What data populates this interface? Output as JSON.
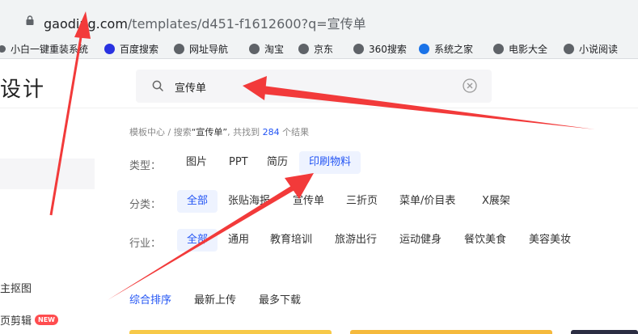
{
  "browser": {
    "url_host": "gaoding.com",
    "url_path": "/templates/d451-f1612600?q=宣传单"
  },
  "bookmarks": [
    {
      "label": "小白一键重装系统",
      "icon": "globe-icon",
      "color": "#5f6368"
    },
    {
      "label": "百度搜索",
      "icon": "baidu-paw-icon",
      "color": "#2932e1"
    },
    {
      "label": "网址导航",
      "icon": "globe-icon",
      "color": "#5f6368"
    },
    {
      "label": "淘宝",
      "icon": "globe-icon",
      "color": "#5f6368"
    },
    {
      "label": "京东",
      "icon": "globe-icon",
      "color": "#5f6368"
    },
    {
      "label": "360搜索",
      "icon": "globe-icon",
      "color": "#5f6368"
    },
    {
      "label": "系统之家",
      "icon": "aperture-icon",
      "color": "#1a73e8"
    },
    {
      "label": "电影大全",
      "icon": "globe-icon",
      "color": "#5f6368"
    },
    {
      "label": "小说阅读",
      "icon": "globe-icon",
      "color": "#5f6368"
    }
  ],
  "site": {
    "title": "设计"
  },
  "search": {
    "value": "宣传单"
  },
  "sidebar": {
    "item_a": "主抠图",
    "item_b": "页剪辑",
    "badge": "NEW"
  },
  "breadcrumb": {
    "root": "模板中心",
    "sep": " / ",
    "prefix": "搜索",
    "query": "“宣传单”",
    "mid": ", 共找到 ",
    "count": "284",
    "suffix": " 个结果"
  },
  "filters": {
    "type": {
      "label": "类型：",
      "options": [
        "图片",
        "PPT",
        "简历",
        "印刷物料"
      ],
      "active": 3
    },
    "category": {
      "label": "分类：",
      "options": [
        "全部",
        "张贴海报",
        "宣传单",
        "三折页",
        "菜单/价目表",
        "X展架"
      ],
      "active": 0
    },
    "industry": {
      "label": "行业：",
      "options": [
        "全部",
        "通用",
        "教育培训",
        "旅游出行",
        "运动健身",
        "餐饮美食",
        "美容美妆"
      ],
      "active": 0
    }
  },
  "sort": {
    "options": [
      "综合排序",
      "最新上传",
      "最多下载"
    ],
    "active": 0
  },
  "colors": {
    "accent": "#2254f4",
    "annotation": "#f23a3a",
    "badge": "#ff4d4f"
  }
}
